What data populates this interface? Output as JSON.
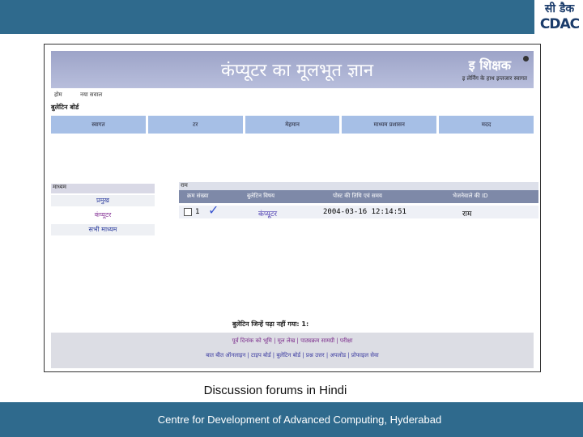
{
  "logo": {
    "hindi": "सी डैक",
    "english": "CDAC"
  },
  "app": {
    "banner_title": "कंप्यूटर का मूलभूत ज्ञान",
    "brand": "इ शिक्षक",
    "banner_sub": "इ लेर्निंग के हाथ इन्तजार स्वागत",
    "nav_links": [
      "होम",
      "नया सवाल"
    ],
    "board_title": "बुलेटिन बोर्ड",
    "tabs": [
      "स्वागत",
      "टर",
      "मेहमान",
      "माध्यम प्रशासन",
      "मदद"
    ]
  },
  "sidebar": {
    "heading": "माध्यम",
    "items": [
      "प्रमुख",
      "कंप्यूटर",
      "सभी माध्यम"
    ]
  },
  "table": {
    "heading": "राम",
    "columns": [
      "क्रम संख्या",
      "बुलेटिन विषय",
      "पोस्ट की तिथि एवं समय",
      "भेजनेवाले की ID"
    ],
    "rows": [
      {
        "serial": "1",
        "subject": "कंप्यूटर",
        "datetime": "2004-03-16 12:14:51",
        "sender": "राम"
      }
    ]
  },
  "unread_note": "बुलेटिन जिन्हें पढ़ा नहीं गया: 1:",
  "footer": {
    "line1": "पूर्व दिनांक को भूमि | मूल लेख | पाठ्यक्रम सामग्री | परीक्षा",
    "line2": "बात बीत ऑनलाइन | टाइप बोर्ड | बुलेटिन बोर्ड | प्रश्न उत्तर | अपलोड | प्रोफाइल सेवा"
  },
  "caption": "Discussion forums in Hindi",
  "bottom_text": "Centre for Development of Advanced Computing, Hyderabad"
}
